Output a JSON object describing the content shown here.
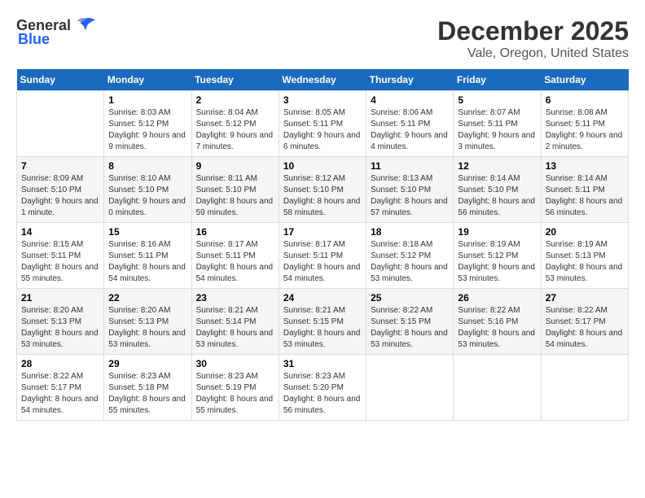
{
  "logo": {
    "general": "General",
    "blue": "Blue"
  },
  "title": "December 2025",
  "subtitle": "Vale, Oregon, United States",
  "days_of_week": [
    "Sunday",
    "Monday",
    "Tuesday",
    "Wednesday",
    "Thursday",
    "Friday",
    "Saturday"
  ],
  "weeks": [
    [
      {
        "day": "",
        "info": ""
      },
      {
        "day": "1",
        "info": "Sunrise: 8:03 AM\nSunset: 5:12 PM\nDaylight: 9 hours and 9 minutes."
      },
      {
        "day": "2",
        "info": "Sunrise: 8:04 AM\nSunset: 5:12 PM\nDaylight: 9 hours and 7 minutes."
      },
      {
        "day": "3",
        "info": "Sunrise: 8:05 AM\nSunset: 5:11 PM\nDaylight: 9 hours and 6 minutes."
      },
      {
        "day": "4",
        "info": "Sunrise: 8:06 AM\nSunset: 5:11 PM\nDaylight: 9 hours and 4 minutes."
      },
      {
        "day": "5",
        "info": "Sunrise: 8:07 AM\nSunset: 5:11 PM\nDaylight: 9 hours and 3 minutes."
      },
      {
        "day": "6",
        "info": "Sunrise: 8:08 AM\nSunset: 5:11 PM\nDaylight: 9 hours and 2 minutes."
      }
    ],
    [
      {
        "day": "7",
        "info": "Sunrise: 8:09 AM\nSunset: 5:10 PM\nDaylight: 9 hours and 1 minute."
      },
      {
        "day": "8",
        "info": "Sunrise: 8:10 AM\nSunset: 5:10 PM\nDaylight: 9 hours and 0 minutes."
      },
      {
        "day": "9",
        "info": "Sunrise: 8:11 AM\nSunset: 5:10 PM\nDaylight: 8 hours and 59 minutes."
      },
      {
        "day": "10",
        "info": "Sunrise: 8:12 AM\nSunset: 5:10 PM\nDaylight: 8 hours and 58 minutes."
      },
      {
        "day": "11",
        "info": "Sunrise: 8:13 AM\nSunset: 5:10 PM\nDaylight: 8 hours and 57 minutes."
      },
      {
        "day": "12",
        "info": "Sunrise: 8:14 AM\nSunset: 5:10 PM\nDaylight: 8 hours and 56 minutes."
      },
      {
        "day": "13",
        "info": "Sunrise: 8:14 AM\nSunset: 5:11 PM\nDaylight: 8 hours and 56 minutes."
      }
    ],
    [
      {
        "day": "14",
        "info": "Sunrise: 8:15 AM\nSunset: 5:11 PM\nDaylight: 8 hours and 55 minutes."
      },
      {
        "day": "15",
        "info": "Sunrise: 8:16 AM\nSunset: 5:11 PM\nDaylight: 8 hours and 54 minutes."
      },
      {
        "day": "16",
        "info": "Sunrise: 8:17 AM\nSunset: 5:11 PM\nDaylight: 8 hours and 54 minutes."
      },
      {
        "day": "17",
        "info": "Sunrise: 8:17 AM\nSunset: 5:11 PM\nDaylight: 8 hours and 54 minutes."
      },
      {
        "day": "18",
        "info": "Sunrise: 8:18 AM\nSunset: 5:12 PM\nDaylight: 8 hours and 53 minutes."
      },
      {
        "day": "19",
        "info": "Sunrise: 8:19 AM\nSunset: 5:12 PM\nDaylight: 8 hours and 53 minutes."
      },
      {
        "day": "20",
        "info": "Sunrise: 8:19 AM\nSunset: 5:13 PM\nDaylight: 8 hours and 53 minutes."
      }
    ],
    [
      {
        "day": "21",
        "info": "Sunrise: 8:20 AM\nSunset: 5:13 PM\nDaylight: 8 hours and 53 minutes."
      },
      {
        "day": "22",
        "info": "Sunrise: 8:20 AM\nSunset: 5:13 PM\nDaylight: 8 hours and 53 minutes."
      },
      {
        "day": "23",
        "info": "Sunrise: 8:21 AM\nSunset: 5:14 PM\nDaylight: 8 hours and 53 minutes."
      },
      {
        "day": "24",
        "info": "Sunrise: 8:21 AM\nSunset: 5:15 PM\nDaylight: 8 hours and 53 minutes."
      },
      {
        "day": "25",
        "info": "Sunrise: 8:22 AM\nSunset: 5:15 PM\nDaylight: 8 hours and 53 minutes."
      },
      {
        "day": "26",
        "info": "Sunrise: 8:22 AM\nSunset: 5:16 PM\nDaylight: 8 hours and 53 minutes."
      },
      {
        "day": "27",
        "info": "Sunrise: 8:22 AM\nSunset: 5:17 PM\nDaylight: 8 hours and 54 minutes."
      }
    ],
    [
      {
        "day": "28",
        "info": "Sunrise: 8:22 AM\nSunset: 5:17 PM\nDaylight: 8 hours and 54 minutes."
      },
      {
        "day": "29",
        "info": "Sunrise: 8:23 AM\nSunset: 5:18 PM\nDaylight: 8 hours and 55 minutes."
      },
      {
        "day": "30",
        "info": "Sunrise: 8:23 AM\nSunset: 5:19 PM\nDaylight: 8 hours and 55 minutes."
      },
      {
        "day": "31",
        "info": "Sunrise: 8:23 AM\nSunset: 5:20 PM\nDaylight: 8 hours and 56 minutes."
      },
      {
        "day": "",
        "info": ""
      },
      {
        "day": "",
        "info": ""
      },
      {
        "day": "",
        "info": ""
      }
    ]
  ]
}
